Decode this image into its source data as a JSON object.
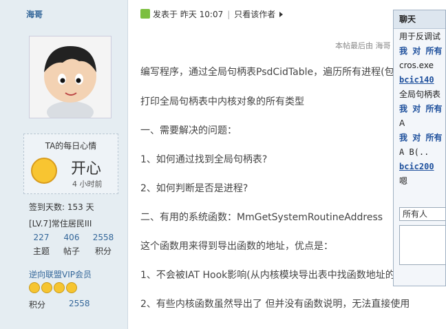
{
  "author": {
    "name": "海哥",
    "mood_title": "TA的每日心情",
    "mood": "开心",
    "mood_time": "4 小时前",
    "checkin": "签到天数: 153 天",
    "level": "[LV.7]常住居民III",
    "stats": [
      {
        "value": "227",
        "label": "主题"
      },
      {
        "value": "406",
        "label": "帖子"
      },
      {
        "value": "2558",
        "label": "积分"
      }
    ],
    "vip": "逆向联盟VIP会员",
    "points_label": "积分",
    "points_value": "2558"
  },
  "post": {
    "posted": "发表于 昨天 10:07",
    "only_author": "只看该作者",
    "last_edit": "本帖最后由 海哥",
    "paragraphs": [
      "编写程序，通过全局句柄表PsdCidTable，遍历所有进程(包",
      "打印全局句柄表中内核对象的所有类型",
      "一、需要解决的问题：",
      "1、如何通过找到全局句柄表?",
      "2、如何判断是否是进程?",
      "二、有用的系统函数：MmGetSystemRoutineAddress",
      "这个函数用来得到导出函数的地址，优点是：",
      "1、不会被IAT Hook影响(从内核模块导出表中找函数地址的",
      "2、有些内核函数虽然导出了 但并没有函数说明，无法直接使用"
    ]
  },
  "chat": {
    "title": "聊天",
    "messages": [
      {
        "text": "用于反调试",
        "style": "normal"
      },
      {
        "text": "我 对 所有",
        "style": "blue"
      },
      {
        "text": "cros.exe",
        "style": "normal"
      },
      {
        "text": "bcic140 ",
        "style": "link"
      },
      {
        "text": "全局句柄表",
        "style": "normal"
      },
      {
        "text": "我 对 所有",
        "style": "blue"
      },
      {
        "text": "A",
        "style": "normal"
      },
      {
        "text": "我 对 所有",
        "style": "blue"
      },
      {
        "text": "A  B(..",
        "style": "mono"
      },
      {
        "text": "bcic200",
        "style": "link"
      },
      {
        "text": "嗯",
        "style": "normal"
      }
    ],
    "recipient": "所有人"
  }
}
